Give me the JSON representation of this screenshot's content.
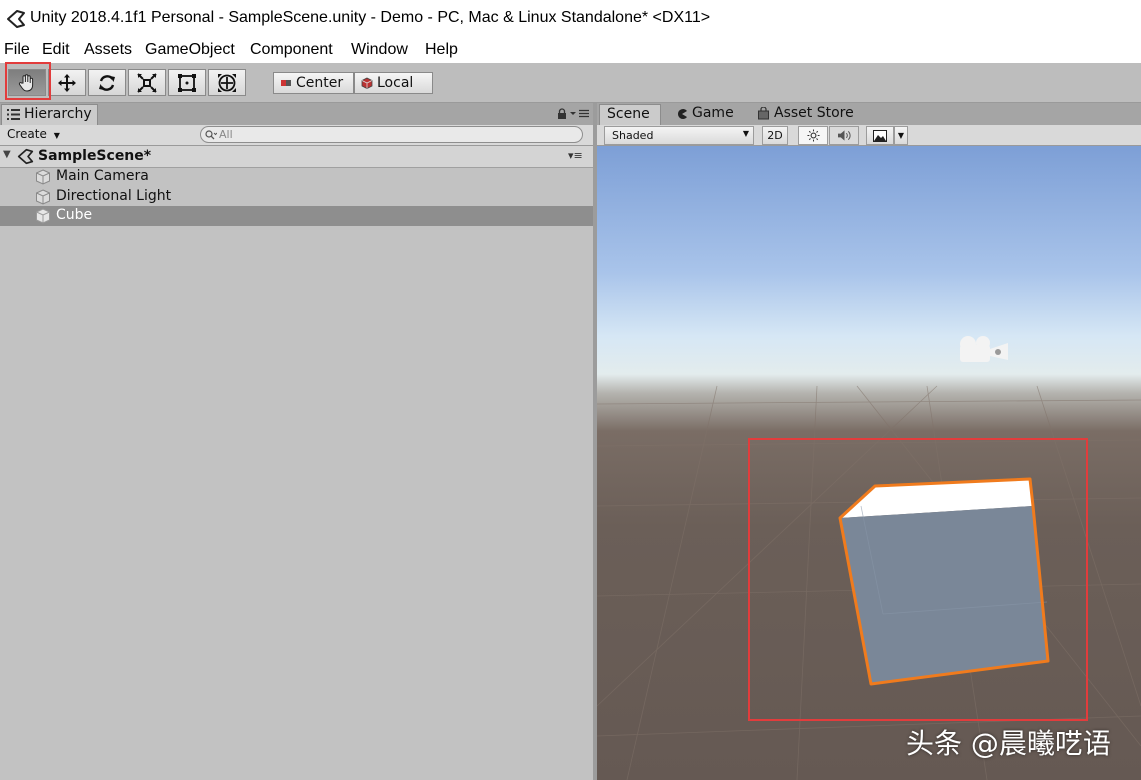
{
  "window": {
    "title": "Unity 2018.4.1f1 Personal - SampleScene.unity - Demo - PC, Mac & Linux Standalone* <DX11>"
  },
  "menu": [
    "File",
    "Edit",
    "Assets",
    "GameObject",
    "Component",
    "Window",
    "Help"
  ],
  "toolbar": {
    "tools": [
      "hand-icon",
      "move-icon",
      "rotate-icon",
      "scale-icon",
      "rect-icon",
      "transform-icon"
    ],
    "active_tool": "hand-icon",
    "pivot_mode": "Center",
    "pivot_space": "Local"
  },
  "hierarchy": {
    "tab_label": "Hierarchy",
    "create_label": "Create",
    "search_placeholder": "All",
    "scene_name": "SampleScene*",
    "items": [
      {
        "label": "Main Camera",
        "selected": false
      },
      {
        "label": "Directional Light",
        "selected": false
      },
      {
        "label": "Cube",
        "selected": true
      }
    ]
  },
  "scene_panel": {
    "tabs": [
      "Scene",
      "Game",
      "Asset Store"
    ],
    "active_tab": "Scene",
    "shading_mode": "Shaded",
    "mode_2d_label": "2D"
  },
  "watermark": "头条 @晨曦呓语",
  "colors": {
    "highlight": "#e23c3c",
    "selection_outline": "#f07b1d",
    "cube_face": "#7a8798"
  }
}
